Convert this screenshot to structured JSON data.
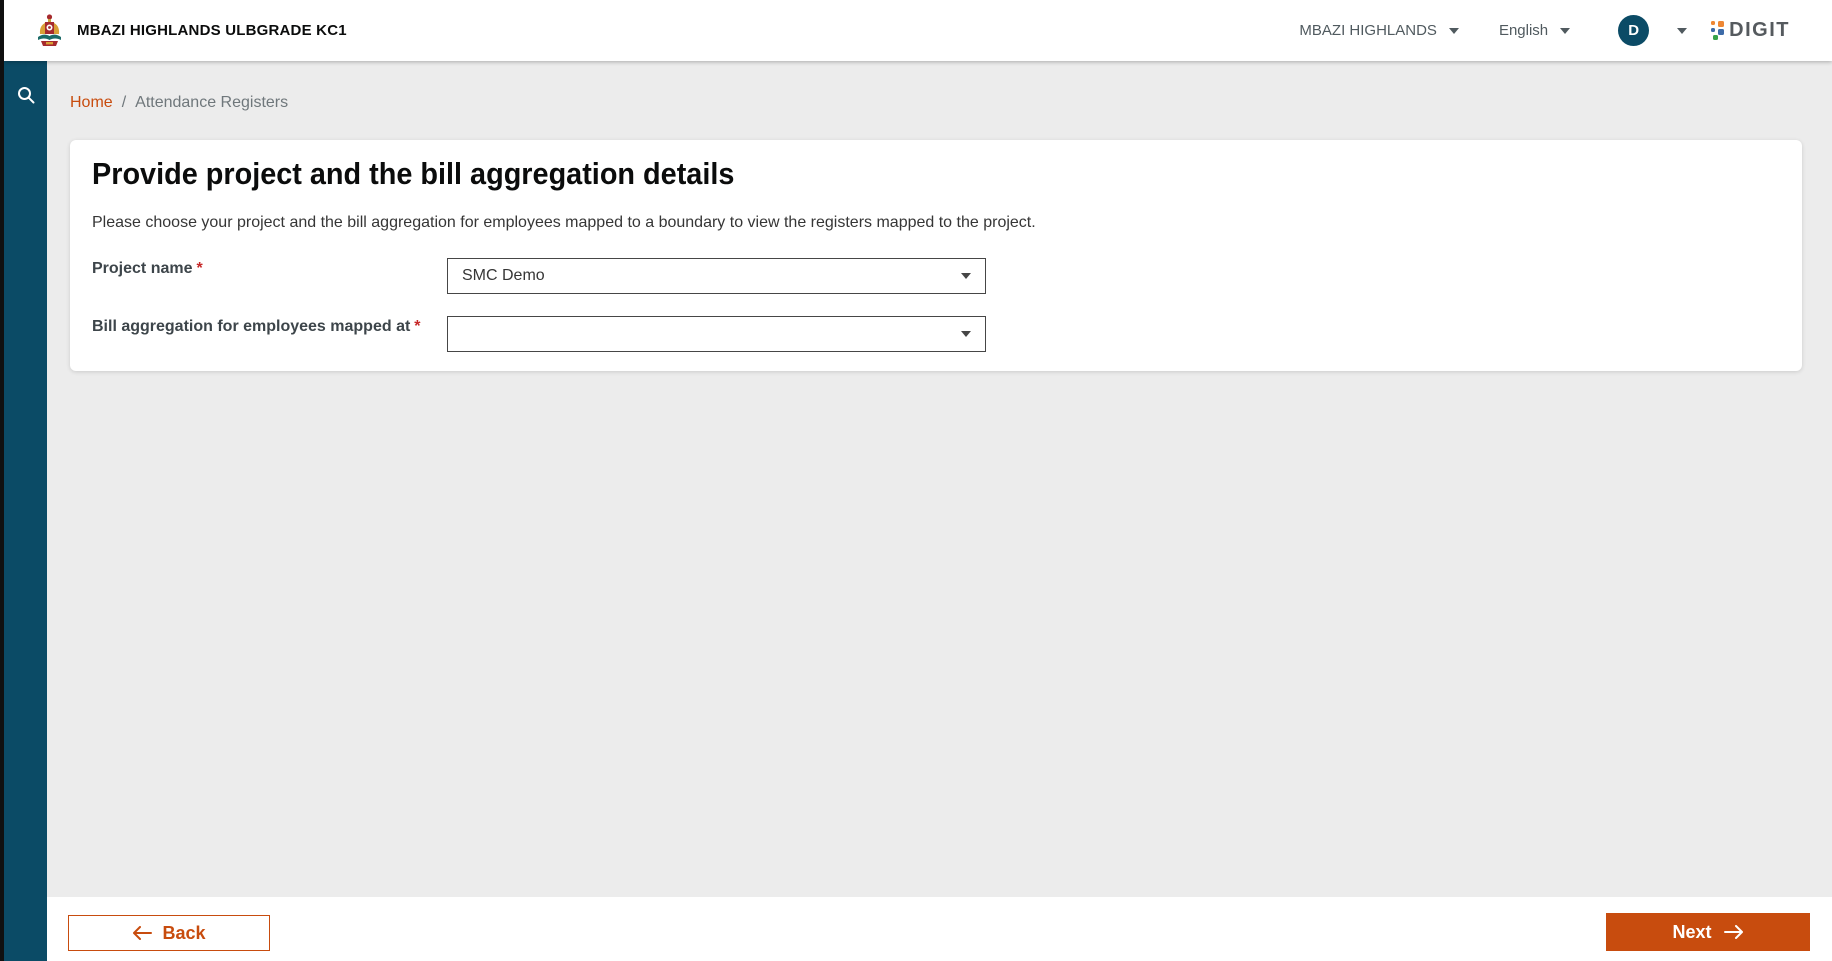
{
  "header": {
    "app_title": "MBAZI HIGHLANDS ULBGRADE KC1",
    "city_selector": "MBAZI HIGHLANDS",
    "language_selector": "English",
    "avatar_initial": "D",
    "brand": "DIGIT"
  },
  "sidebar": {
    "items": [
      {
        "icon": "search-icon"
      }
    ]
  },
  "breadcrumb": {
    "home": "Home",
    "separator": "/",
    "current": "Attendance Registers"
  },
  "card": {
    "heading": "Provide project and the bill aggregation details",
    "description": "Please choose your project and the bill aggregation for employees mapped to a boundary to view the registers mapped to the project.",
    "fields": [
      {
        "label": "Project name",
        "required_marker": "*",
        "value": "SMC Demo"
      },
      {
        "label": "Bill aggregation for employees mapped at",
        "required_marker": "*",
        "value": ""
      }
    ]
  },
  "footer": {
    "back_label": "Back",
    "next_label": "Next"
  },
  "icons": {
    "search": "magnifying-glass",
    "dropdown_caret": "▾",
    "back_arrow": "←",
    "next_arrow": "→"
  },
  "colors": {
    "primary_orange": "#C84C0E",
    "sidebar_teal": "#0B4B66",
    "header_bg": "#FFFFFF",
    "content_bg": "#ECECEC",
    "required_red": "#C62828",
    "digit_orange": "#EE8734",
    "digit_blue": "#3D6BA8",
    "digit_green": "#37A34A"
  }
}
